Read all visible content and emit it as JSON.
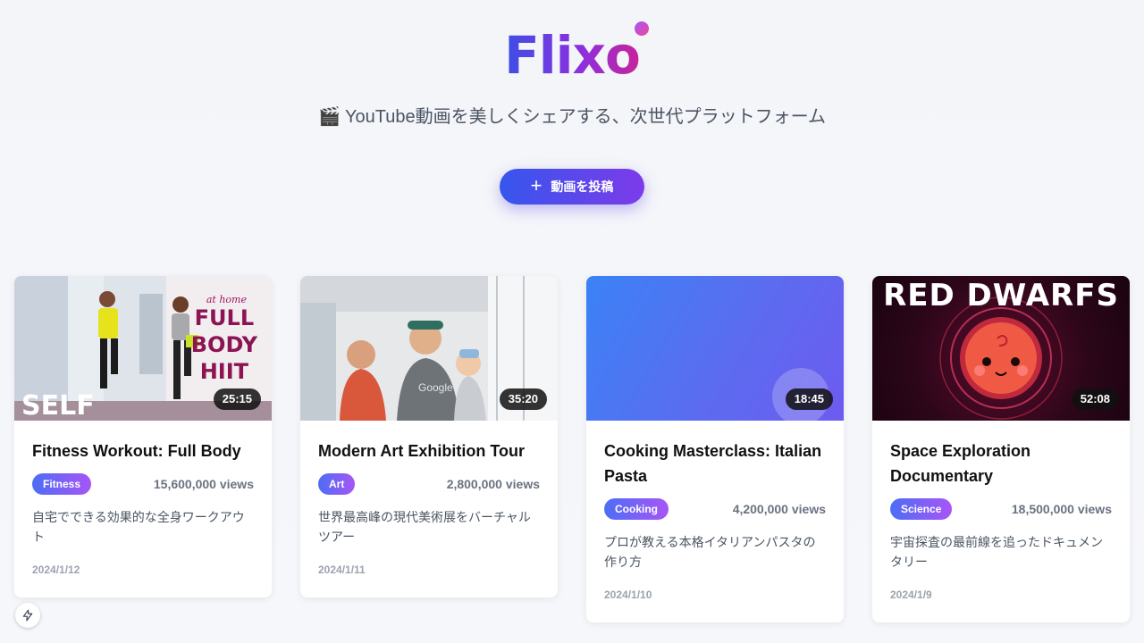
{
  "header": {
    "logo": "Flixo",
    "tagline": "🎬 YouTube動画を美しくシェアする、次世代プラットフォーム",
    "post_button": "動画を投稿",
    "post_icon": "plus-icon"
  },
  "thumbs": {
    "card1_overlay": "at home",
    "card1_lines": [
      "FULL",
      "BODY",
      "HIIT"
    ],
    "card1_brand": "SELF",
    "card2_shirt": "Google",
    "card4_overlay": "RED DWARFS"
  },
  "cards": [
    {
      "title": "Fitness Workout: Full Body",
      "category": "Fitness",
      "views": "15,600,000 views",
      "description": "自宅でできる効果的な全身ワークアウト",
      "date": "2024/1/12",
      "duration": "25:15"
    },
    {
      "title": "Modern Art Exhibition Tour",
      "category": "Art",
      "views": "2,800,000 views",
      "description": "世界最高峰の現代美術展をバーチャルツアー",
      "date": "2024/1/11",
      "duration": "35:20"
    },
    {
      "title": "Cooking Masterclass: Italian Pasta",
      "category": "Cooking",
      "views": "4,200,000 views",
      "description": "プロが教える本格イタリアンパスタの作り方",
      "date": "2024/1/10",
      "duration": "18:45"
    },
    {
      "title": "Space Exploration Documentary",
      "category": "Science",
      "views": "18,500,000 views",
      "description": "宇宙探査の最前線を追ったドキュメンタリー",
      "date": "2024/1/9",
      "duration": "52:08"
    }
  ],
  "colors": {
    "brand_start": "#3b4fe4",
    "brand_end": "#c8249a",
    "button_start": "#3656ec",
    "button_end": "#7d3bea"
  },
  "bottom_icon": "bolt-icon"
}
